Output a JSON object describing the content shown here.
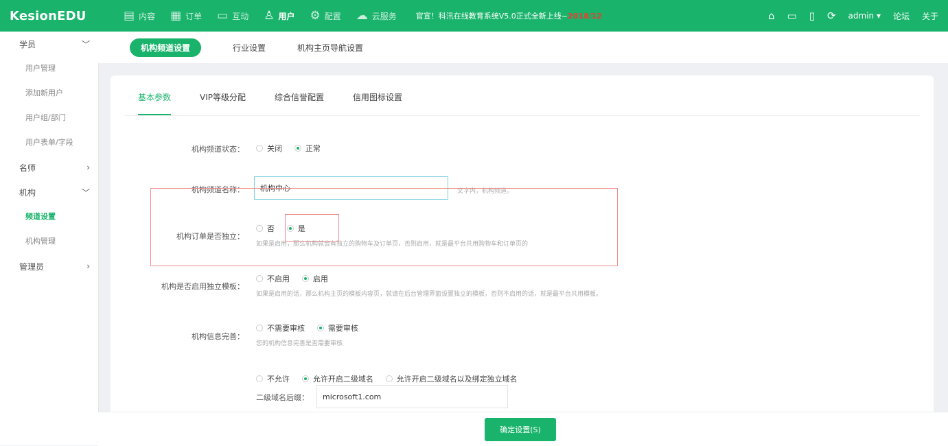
{
  "app": {
    "logo": "KesionEDU"
  },
  "topnav": {
    "items": [
      {
        "label": "内容",
        "icon": "document-icon",
        "glyph": "▤"
      },
      {
        "label": "订单",
        "icon": "clipboard-icon",
        "glyph": "▦"
      },
      {
        "label": "互动",
        "icon": "chat-icon",
        "glyph": "▭"
      },
      {
        "label": "用户",
        "icon": "user-icon",
        "glyph": "♙"
      },
      {
        "label": "配置",
        "icon": "gear-icon",
        "glyph": "⚙"
      },
      {
        "label": "云服务",
        "icon": "cloud-icon",
        "glyph": "☁"
      }
    ],
    "notice_text": "官宣！科汛在线教育系统V5.0正式全新上线~",
    "notice_date": "2018/12"
  },
  "topright": {
    "home_glyph": "⌂",
    "monitor_glyph": "▭",
    "mobile_glyph": "▯",
    "refresh_glyph": "⟳",
    "user": "admin ▾",
    "forum": "论坛",
    "about": "关于"
  },
  "sidebar": {
    "groups": [
      {
        "label": "学员",
        "chevron": "﹀",
        "items": [
          "用户管理",
          "添加新用户",
          "用户组/部门",
          "用户表单/字段"
        ]
      },
      {
        "label": "名师",
        "chevron": "›",
        "items": []
      },
      {
        "label": "机构",
        "chevron": "﹀",
        "items": [
          "频道设置",
          "机构管理"
        ]
      },
      {
        "label": "管理员",
        "chevron": "›",
        "items": []
      }
    ]
  },
  "subtabs": [
    "机构频道设置",
    "行业设置",
    "机构主页导航设置"
  ],
  "tabs": [
    "基本参数",
    "VIP等级分配",
    "综合信誉配置",
    "信用图标设置"
  ],
  "form": {
    "status": {
      "label": "机构频道状态：",
      "options": [
        "关闭",
        "正常"
      ]
    },
    "name": {
      "label": "机构频道名称：",
      "value": "机构中心",
      "hint": "文字内，机构频道。"
    },
    "order": {
      "label": "机构订单是否独立：",
      "options": [
        "否",
        "是"
      ],
      "hint": "如果是启用，那么机构就会有独立的购物车及订单页，否则启用，就是最平台共用购物车和订单页的"
    },
    "template": {
      "label": "机构是否启用独立模板：",
      "options": [
        "不启用",
        "启用"
      ],
      "hint": "如果是启用的话，那么机构主页的模板内容页，就请在后台管理界面设置独立的模板，否则不启用的话，就是最平台共用模板。"
    },
    "audit": {
      "label": "机构信息完善：",
      "options": [
        "不需要审核",
        "需要审核"
      ],
      "hint": "您的机构信息完善是否需要审核"
    },
    "domain": {
      "options": [
        "不允许",
        "允许开启二级域名",
        "允许开启二级域名以及绑定独立域名"
      ],
      "suffix_label": "二级域名后缀：",
      "suffix_value": "microsoft1.com"
    }
  },
  "bottom": {
    "confirm_label": "确定设置(S)"
  },
  "colors": {
    "brand": "#19b36b",
    "highlight_box": "#f08a8a",
    "date": "#e8402f"
  }
}
